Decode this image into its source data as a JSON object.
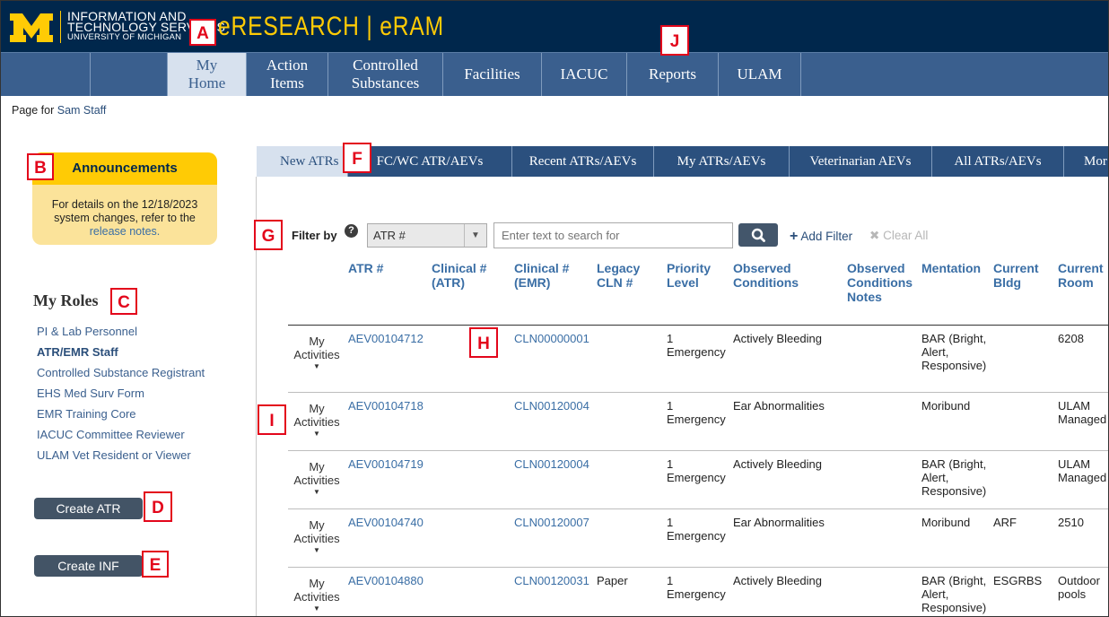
{
  "header": {
    "org_line1": "INFORMATION AND",
    "org_line2": "TECHNOLOGY SERVICES",
    "org_line3": "UNIVERSITY OF MICHIGAN",
    "app_title": "eRESEARCH | eRAM",
    "colors": {
      "header_bg": "#00274c",
      "maize": "#ffcb05",
      "nav_bg": "#3a5f8e"
    }
  },
  "nav": {
    "items": [
      {
        "label": "My\nHome",
        "active": true
      },
      {
        "label": "Action\nItems"
      },
      {
        "label": "Controlled\nSubstances"
      },
      {
        "label": "Facilities"
      },
      {
        "label": "IACUC"
      },
      {
        "label": "Reports"
      },
      {
        "label": "ULAM"
      }
    ]
  },
  "page_for": {
    "prefix": "Page for",
    "user": "Sam Staff"
  },
  "announcements": {
    "title": "Announcements",
    "line1": "For details on the 12/18/2023",
    "line2": "system changes, refer to the",
    "link": "release notes."
  },
  "roles": {
    "title": "My Roles",
    "items": [
      {
        "label": "PI & Lab Personnel"
      },
      {
        "label": "ATR/EMR Staff",
        "bold": true
      },
      {
        "label": "Controlled Substance Registrant"
      },
      {
        "label": "EHS Med Surv Form"
      },
      {
        "label": "EMR Training Core"
      },
      {
        "label": "IACUC Committee Reviewer"
      },
      {
        "label": "ULAM Vet Resident or Viewer"
      }
    ]
  },
  "buttons": {
    "create_atr": "Create ATR",
    "create_inf": "Create INF"
  },
  "tabs": [
    {
      "label": "New ATRs",
      "active": true
    },
    {
      "label": "FC/WC ATR/AEVs"
    },
    {
      "label": "Recent ATRs/AEVs"
    },
    {
      "label": "My ATRs/AEVs"
    },
    {
      "label": "Veterinarian AEVs"
    },
    {
      "label": "All ATRs/AEVs"
    },
    {
      "label": "Mor"
    }
  ],
  "filter": {
    "label": "Filter by",
    "help_icon": "question-circle-icon",
    "select_value": "ATR #",
    "search_placeholder": "Enter text to search for",
    "add_filter": "Add Filter",
    "clear_all": "Clear All"
  },
  "table": {
    "columns": [
      "ATR #",
      "Clinical #\n(ATR)",
      "Clinical #\n(EMR)",
      "Legacy\nCLN #",
      "Priority\nLevel",
      "Observed\nConditions",
      "Observed\nConditions\nNotes",
      "Mentation",
      "Current\nBldg",
      "Current\nRoom"
    ],
    "activities_label": "My\nActivities",
    "rows": [
      {
        "atr": "AEV00104712",
        "clin_atr": "",
        "clin_emr": "CLN00000001",
        "legacy": "",
        "priority": "1\nEmergency",
        "observed": "Actively Bleeding",
        "notes": "",
        "mentation": "BAR (Bright,\nAlert,\nResponsive)",
        "bldg": "",
        "room": "6208"
      },
      {
        "atr": "AEV00104718",
        "clin_atr": "",
        "clin_emr": "CLN00120004",
        "legacy": "",
        "priority": "1\nEmergency",
        "observed": "Ear Abnormalities",
        "notes": "",
        "mentation": "Moribund",
        "bldg": "",
        "room": "ULAM\nManaged"
      },
      {
        "atr": "AEV00104719",
        "clin_atr": "",
        "clin_emr": "CLN00120004",
        "legacy": "",
        "priority": "1\nEmergency",
        "observed": "Actively Bleeding",
        "notes": "",
        "mentation": "BAR (Bright,\nAlert,\nResponsive)",
        "bldg": "",
        "room": "ULAM\nManaged"
      },
      {
        "atr": "AEV00104740",
        "clin_atr": "",
        "clin_emr": "CLN00120007",
        "legacy": "",
        "priority": "1\nEmergency",
        "observed": "Ear Abnormalities",
        "notes": "",
        "mentation": "Moribund",
        "bldg": "ARF",
        "room": "2510"
      },
      {
        "atr": "AEV00104880",
        "clin_atr": "",
        "clin_emr": "CLN00120031",
        "legacy": "Paper",
        "priority": "1\nEmergency",
        "observed": "Actively Bleeding",
        "notes": "",
        "mentation": "BAR (Bright,\nAlert,\nResponsive)",
        "bldg": "ESGRBS",
        "room": "Outdoor\npools"
      }
    ]
  },
  "callouts": [
    "A",
    "B",
    "C",
    "D",
    "E",
    "F",
    "G",
    "H",
    "I",
    "J"
  ]
}
